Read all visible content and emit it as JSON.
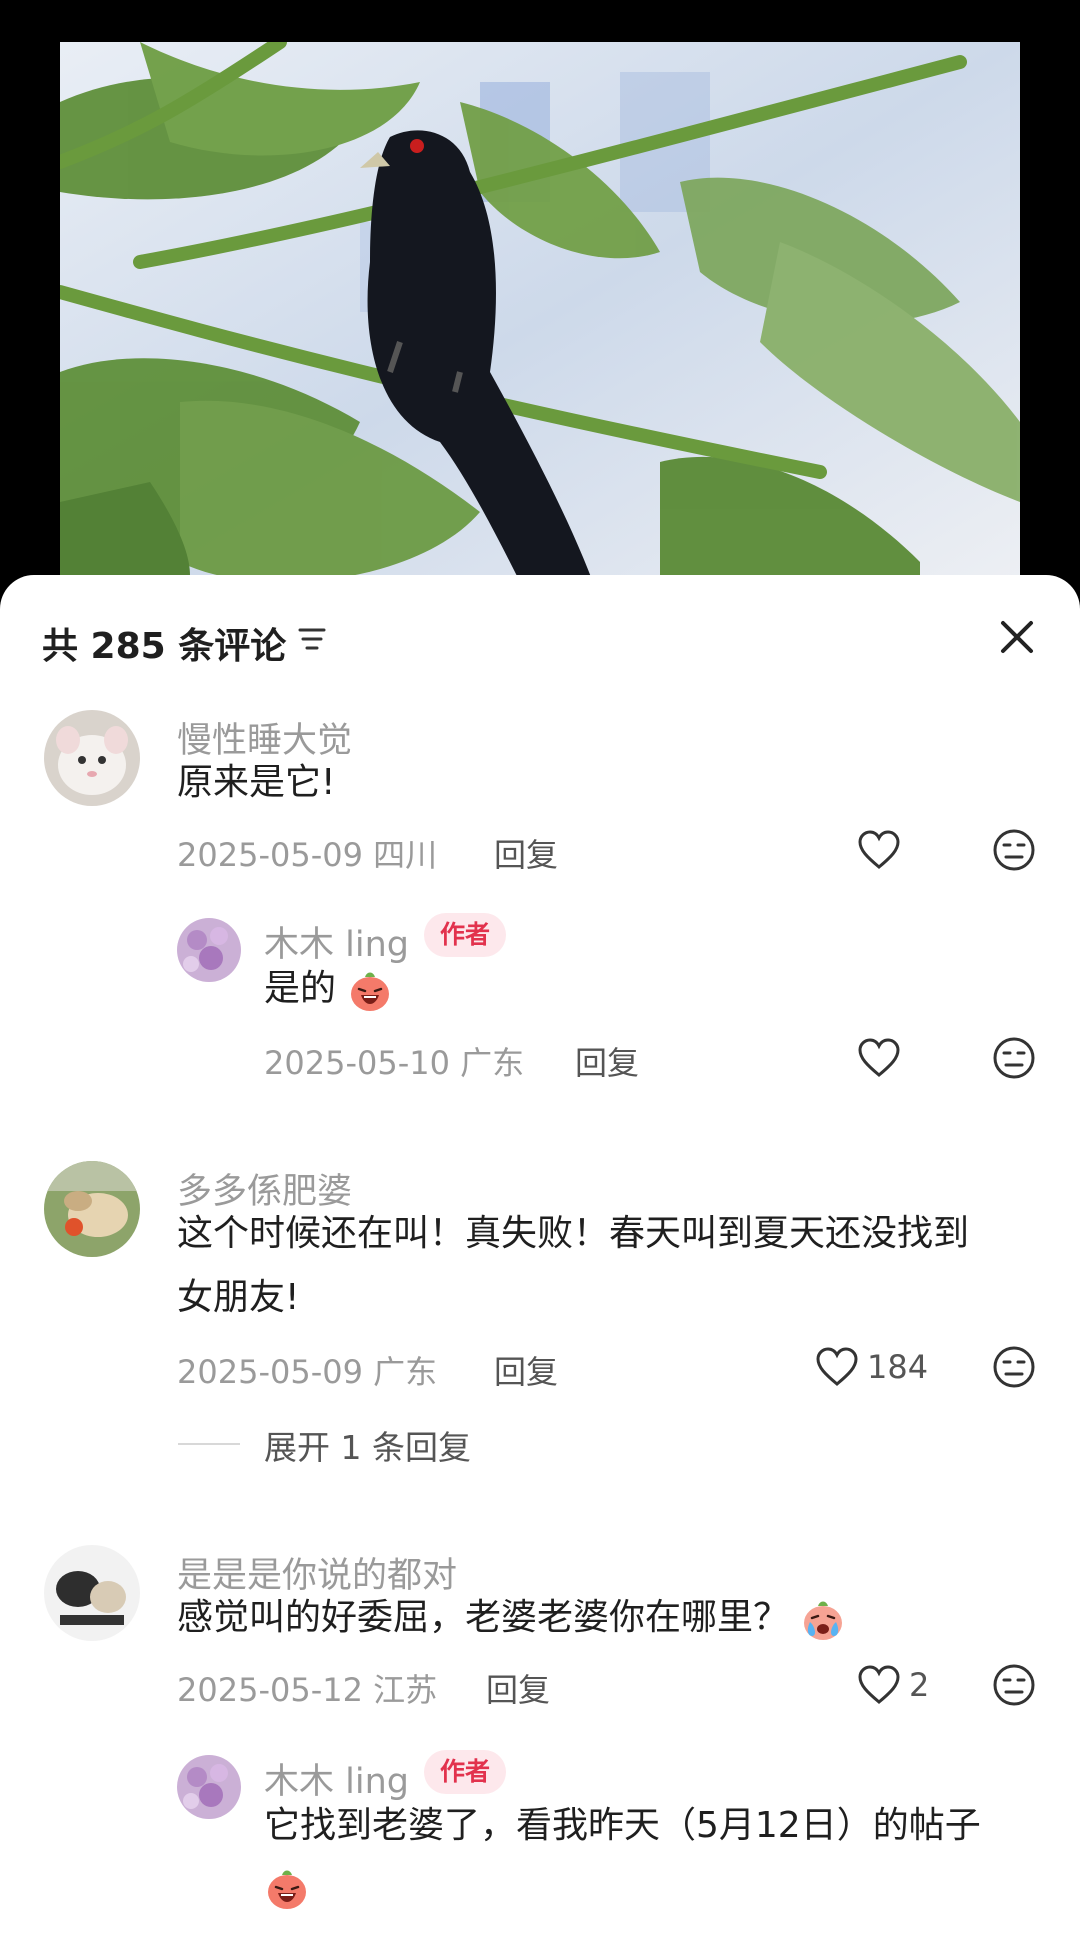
{
  "header": {
    "comment_count_label": "共 285 条评论"
  },
  "comments": [
    {
      "author": "慢性睡大觉",
      "text": "原来是它!",
      "date_location": "2025-05-09 四川",
      "reply_label": "回复",
      "likes": "",
      "replies": [
        {
          "author": "木木 ling",
          "badge": "作者",
          "text": "是的",
          "date_location": "2025-05-10 广东",
          "reply_label": "回复",
          "likes": ""
        }
      ]
    },
    {
      "author": "多多係肥婆",
      "text_line1": "这个时候还在叫！真失败！春天叫到夏天还没找到",
      "text_line2": "女朋友!",
      "date_location": "2025-05-09 广东",
      "reply_label": "回复",
      "likes": "184",
      "expand_label": "展开 1 条回复"
    },
    {
      "author": "是是是你说的都对",
      "text": "感觉叫的好委屈，老婆老婆你在哪里？",
      "date_location": "2025-05-12 江苏",
      "reply_label": "回复",
      "likes": "2",
      "replies": [
        {
          "author": "木木 ling",
          "badge": "作者",
          "text": "它找到老婆了，看我昨天（5月12日）的帖子"
        }
      ]
    }
  ],
  "icons": {
    "sort": "filter-lines-icon",
    "close": "close-icon",
    "like": "heart-outline-icon",
    "dislike": "meh-face-icon",
    "emoji_grin": "grinning-peach-emoji",
    "emoji_cry": "crying-peach-emoji"
  },
  "colors": {
    "badge_bg": "#fde8ec",
    "badge_text": "#e2324d",
    "muted_text": "#9a9a9a"
  }
}
